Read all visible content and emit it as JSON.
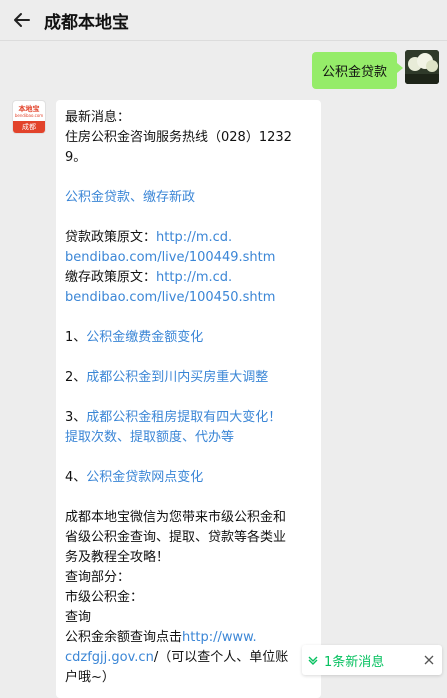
{
  "header": {
    "title": "成都本地宝"
  },
  "outgoing": {
    "text": "公积金贷款"
  },
  "bot_avatar": {
    "logo_text": "本地宝",
    "logo_sub": "bendibao.com",
    "city": "成都"
  },
  "message": {
    "lines": [
      "最新消息：",
      "住房公积金咨询服务热线（028）1232",
      "9。",
      "公积金贷款、缴存新政",
      "贷款政策原文：",
      "http://m.cd.",
      "bendibao.com/live/100449.shtm",
      "缴存政策原文：",
      "http://m.cd.",
      "bendibao.com/live/100450.shtm",
      "1、",
      "公积金缴费金额变化",
      "2、",
      "成都公积金到川内买房重大调整",
      "3、",
      "成都公积金租房提取有四大变化！",
      "提取次数、提取额度、代办等",
      "4、",
      "公积金贷款网点变化",
      "成都本地宝微信为您带来市级公积金和",
      "省级公积金查询、提取、贷款等各类业",
      "务及教程全攻略！",
      "查询部分：",
      "市级公积金：",
      "查询",
      "公积金余额查询点击",
      "http://www.",
      "cdzfgjj.gov.cn",
      "/（可以查个人、单位账",
      "户哦~）"
    ]
  },
  "new_message": {
    "text": "1条新消息"
  },
  "colors": {
    "link": "#3b86d6",
    "bubble_out": "#95ec69",
    "notice": "#07c160"
  }
}
